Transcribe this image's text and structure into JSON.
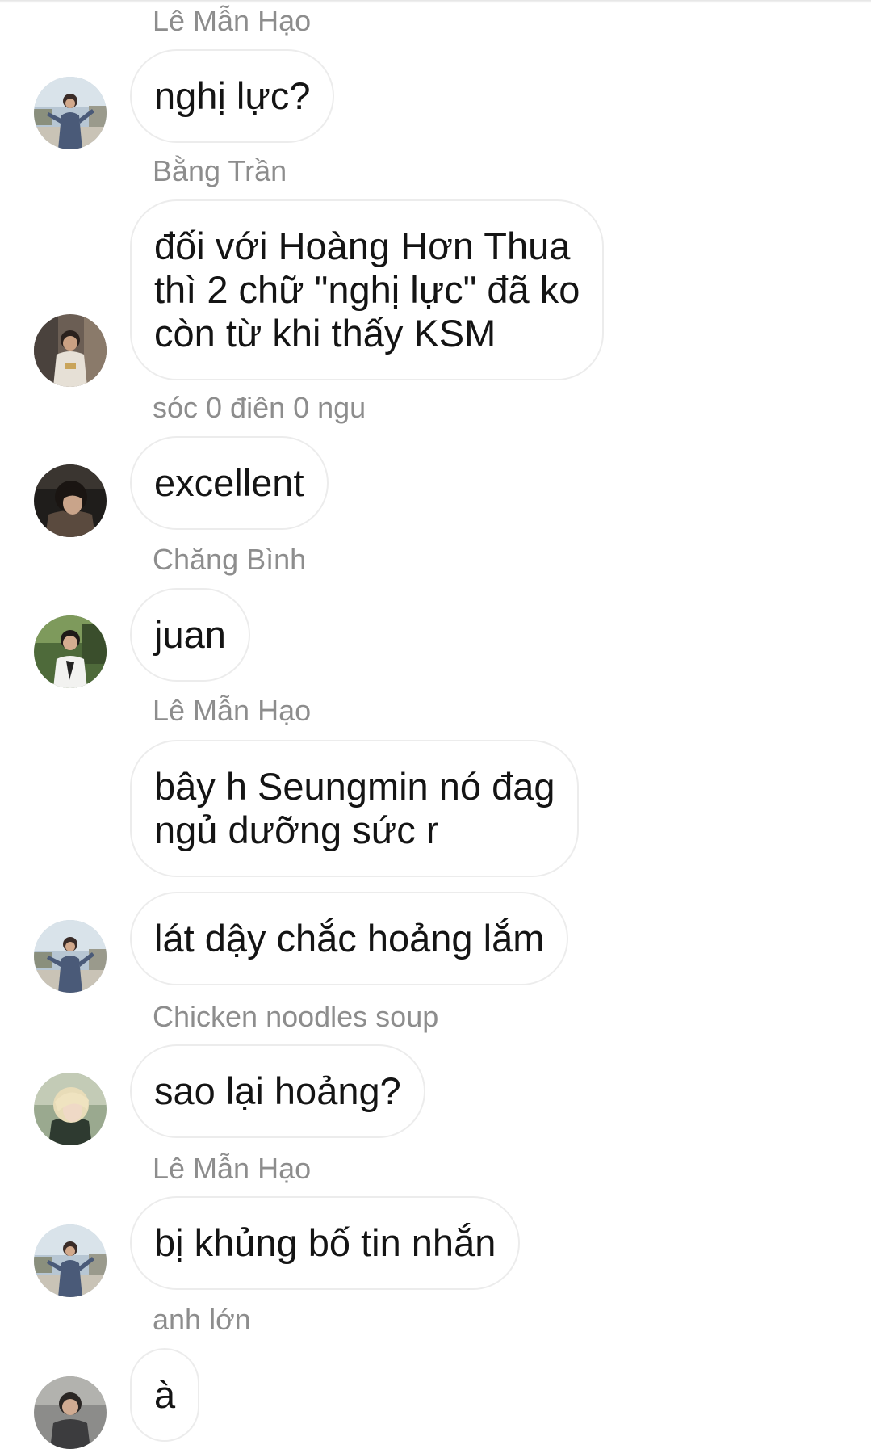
{
  "messages": [
    {
      "sender": "Lê Mẫn Hạo",
      "lines": [
        "nghị lực?"
      ],
      "avatar": "avatar-photo-man-street"
    },
    {
      "sender": "Bằng Trần",
      "lines": [
        "đối với Hoàng Hơn Thua",
        "thì 2 chữ \"nghị lực\" đã ko",
        "còn từ khi thấy KSM"
      ],
      "avatar": "avatar-photo-man-beige"
    },
    {
      "sender": "sóc 0 điên 0 ngu",
      "lines": [
        "excellent"
      ],
      "avatar": "avatar-photo-dark-hair"
    },
    {
      "sender": "Chăng Bình",
      "lines": [
        "juan"
      ],
      "avatar": "avatar-photo-outdoor-green"
    },
    {
      "sender": "Lê Mẫn Hạo",
      "lines": [
        "bây h Seungmin nó đag",
        "ngủ dưỡng sức r"
      ],
      "avatar": ""
    },
    {
      "sender": "",
      "lines": [
        "lát dậy chắc hoảng lắm"
      ],
      "avatar": "avatar-photo-man-street"
    },
    {
      "sender": "Chicken noodles soup",
      "lines": [
        "sao lại hoảng?"
      ],
      "avatar": "avatar-photo-blonde"
    },
    {
      "sender": "Lê Mẫn Hạo",
      "lines": [
        "bị khủng bố tin nhắn"
      ],
      "avatar": "avatar-photo-man-street"
    },
    {
      "sender": "anh lớn",
      "lines": [
        "à"
      ],
      "avatar": "avatar-photo-man-grey"
    }
  ],
  "colors": {
    "background": "#ffffff",
    "bubble_border": "#ececec",
    "sender_text": "#8d8d8d",
    "message_text": "#141414"
  }
}
